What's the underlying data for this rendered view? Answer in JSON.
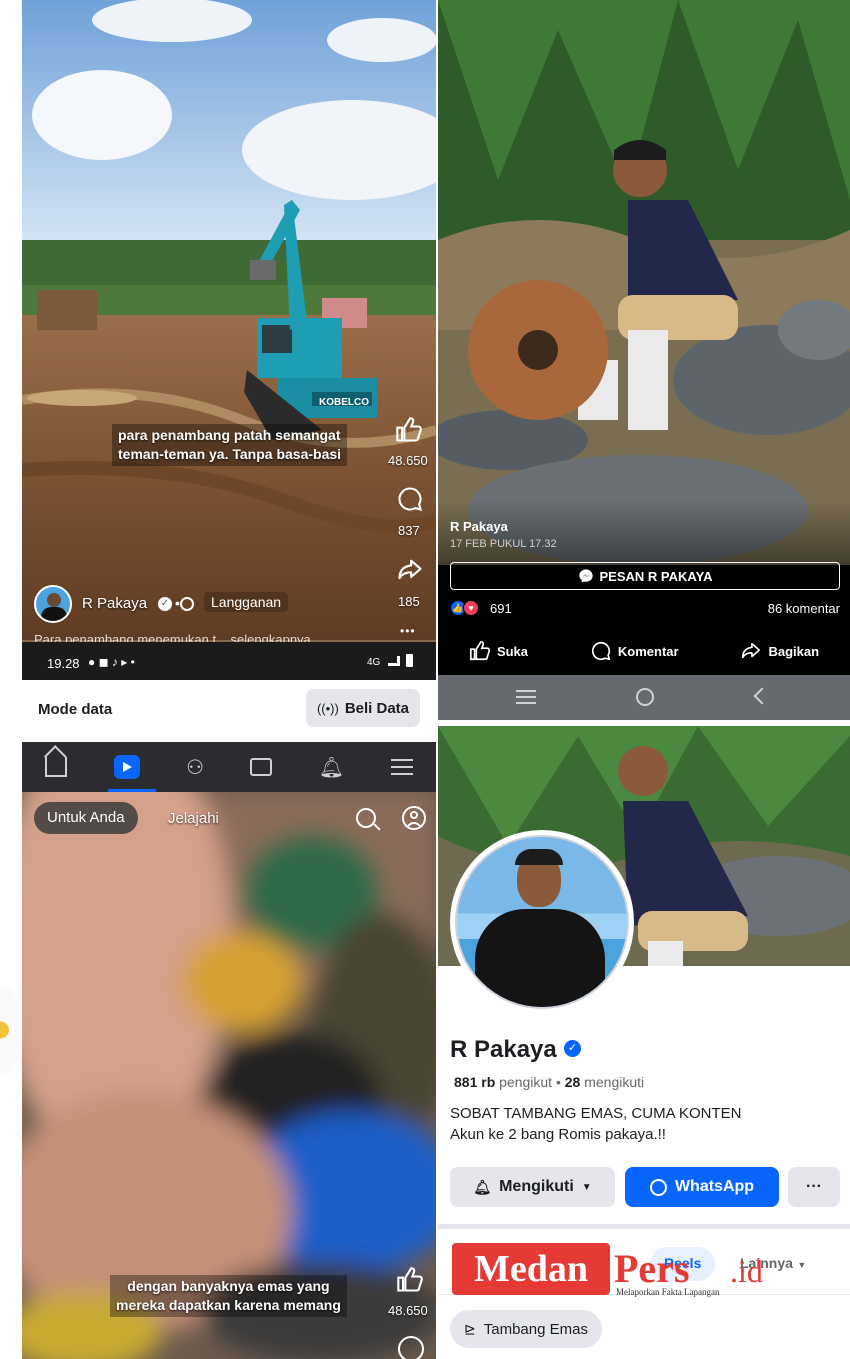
{
  "panel_tl": {
    "caption_line1": "para penambang patah semangat",
    "caption_line2": "teman-teman ya. Tanpa basa-basi",
    "like_count": "48.650",
    "comment_count": "837",
    "share_count": "185",
    "more": "•••",
    "author": "R Pakaya",
    "subscribe": "Langganan",
    "truncated_text": "Para penambang menemukan t... selengkapnya",
    "excavator_brand": "KOBELCO",
    "status_time": "19.28",
    "status_right": "4G"
  },
  "panel_tr": {
    "author": "R Pakaya",
    "date": "17 FEB PUKUL 17.32",
    "message_button": "PESAN R PAKAYA",
    "reaction_count": "691",
    "comment_count": "86 komentar",
    "like_label": "Suka",
    "comment_label": "Komentar",
    "share_label": "Bagikan"
  },
  "data_bar": {
    "label": "Mode data",
    "buy_button": "Beli Data"
  },
  "panel_bl": {
    "tab_foryou": "Untuk Anda",
    "tab_explore": "Jelajahi",
    "caption_line1": "dengan banyaknya emas yang",
    "caption_line2": "mereka dapatkan karena memang",
    "like_count": "48.650"
  },
  "panel_br": {
    "name": "R Pakaya",
    "followers_count": "881 rb",
    "followers_label": "pengikut",
    "following_count": "28",
    "following_label": "mengikuti",
    "bio_line1": "SOBAT TAMBANG EMAS, CUMA KONTEN",
    "bio_line2": "Akun ke 2 bang Romis pakaya.!!",
    "following_button": "Mengikuti",
    "whatsapp_button": "WhatsApp",
    "more_button": "···",
    "tab_reels": "Reels",
    "tab_more": "Lainnya",
    "chip": "Tambang Emas"
  },
  "watermark": {
    "brand_part1": "Medan",
    "brand_part2": "Pers",
    "brand_suffix": ".id",
    "tagline": "Melaporkan Fakta Lapangan"
  },
  "colors": {
    "fb_blue": "#0866ff",
    "dark_bar": "#1c1e21",
    "watermark_red": "#e53935"
  }
}
